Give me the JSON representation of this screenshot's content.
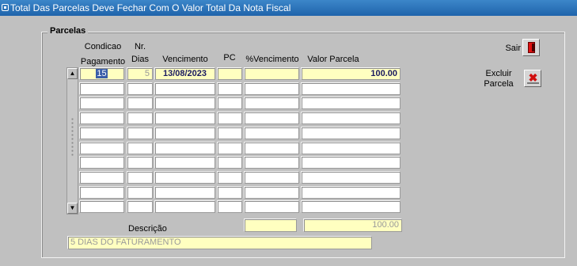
{
  "window": {
    "title": "Total Das Parcelas Deve Fechar Com O Valor Total Da Nota Fiscal"
  },
  "group": {
    "label": "Parcelas"
  },
  "headers": {
    "condicao_line1": "Condicao",
    "condicao_line2": "Pagamento",
    "dias_line1": "Nr.",
    "dias_line2": "Dias",
    "vencimento": "Vencimento",
    "pc": "PC",
    "perc_vencimento": "%Vencimento",
    "valor_parcela": "Valor Parcela"
  },
  "rows": [
    {
      "condicao": "15",
      "dias": "5",
      "vencimento": "13/08/2023",
      "pc": "",
      "perc": "",
      "valor": "100.00"
    },
    {
      "condicao": "",
      "dias": "",
      "vencimento": "",
      "pc": "",
      "perc": "",
      "valor": ""
    },
    {
      "condicao": "",
      "dias": "",
      "vencimento": "",
      "pc": "",
      "perc": "",
      "valor": ""
    },
    {
      "condicao": "",
      "dias": "",
      "vencimento": "",
      "pc": "",
      "perc": "",
      "valor": ""
    },
    {
      "condicao": "",
      "dias": "",
      "vencimento": "",
      "pc": "",
      "perc": "",
      "valor": ""
    },
    {
      "condicao": "",
      "dias": "",
      "vencimento": "",
      "pc": "",
      "perc": "",
      "valor": ""
    },
    {
      "condicao": "",
      "dias": "",
      "vencimento": "",
      "pc": "",
      "perc": "",
      "valor": ""
    },
    {
      "condicao": "",
      "dias": "",
      "vencimento": "",
      "pc": "",
      "perc": "",
      "valor": ""
    },
    {
      "condicao": "",
      "dias": "",
      "vencimento": "",
      "pc": "",
      "perc": "",
      "valor": ""
    },
    {
      "condicao": "",
      "dias": "",
      "vencimento": "",
      "pc": "",
      "perc": "",
      "valor": ""
    }
  ],
  "totals": {
    "percent": "",
    "valor": "100.00"
  },
  "descricao": {
    "label": "Descrição",
    "value": "5 DIAS DO FATURAMENTO"
  },
  "buttons": {
    "sair_label": "Sair",
    "excluir_line1": "Excluir",
    "excluir_line2": "Parcela"
  },
  "icons": {
    "window": "window-icon",
    "sair": "exit-door-icon",
    "excluir": "delete-x-icon",
    "scroll_up": "scroll-up-arrow-icon",
    "scroll_down": "scroll-down-arrow-icon"
  },
  "colors": {
    "titlebar": "#1f64ab",
    "filled_field": "#ffffc0",
    "selection": "#3a5ea8",
    "delete_red": "#d01010"
  }
}
